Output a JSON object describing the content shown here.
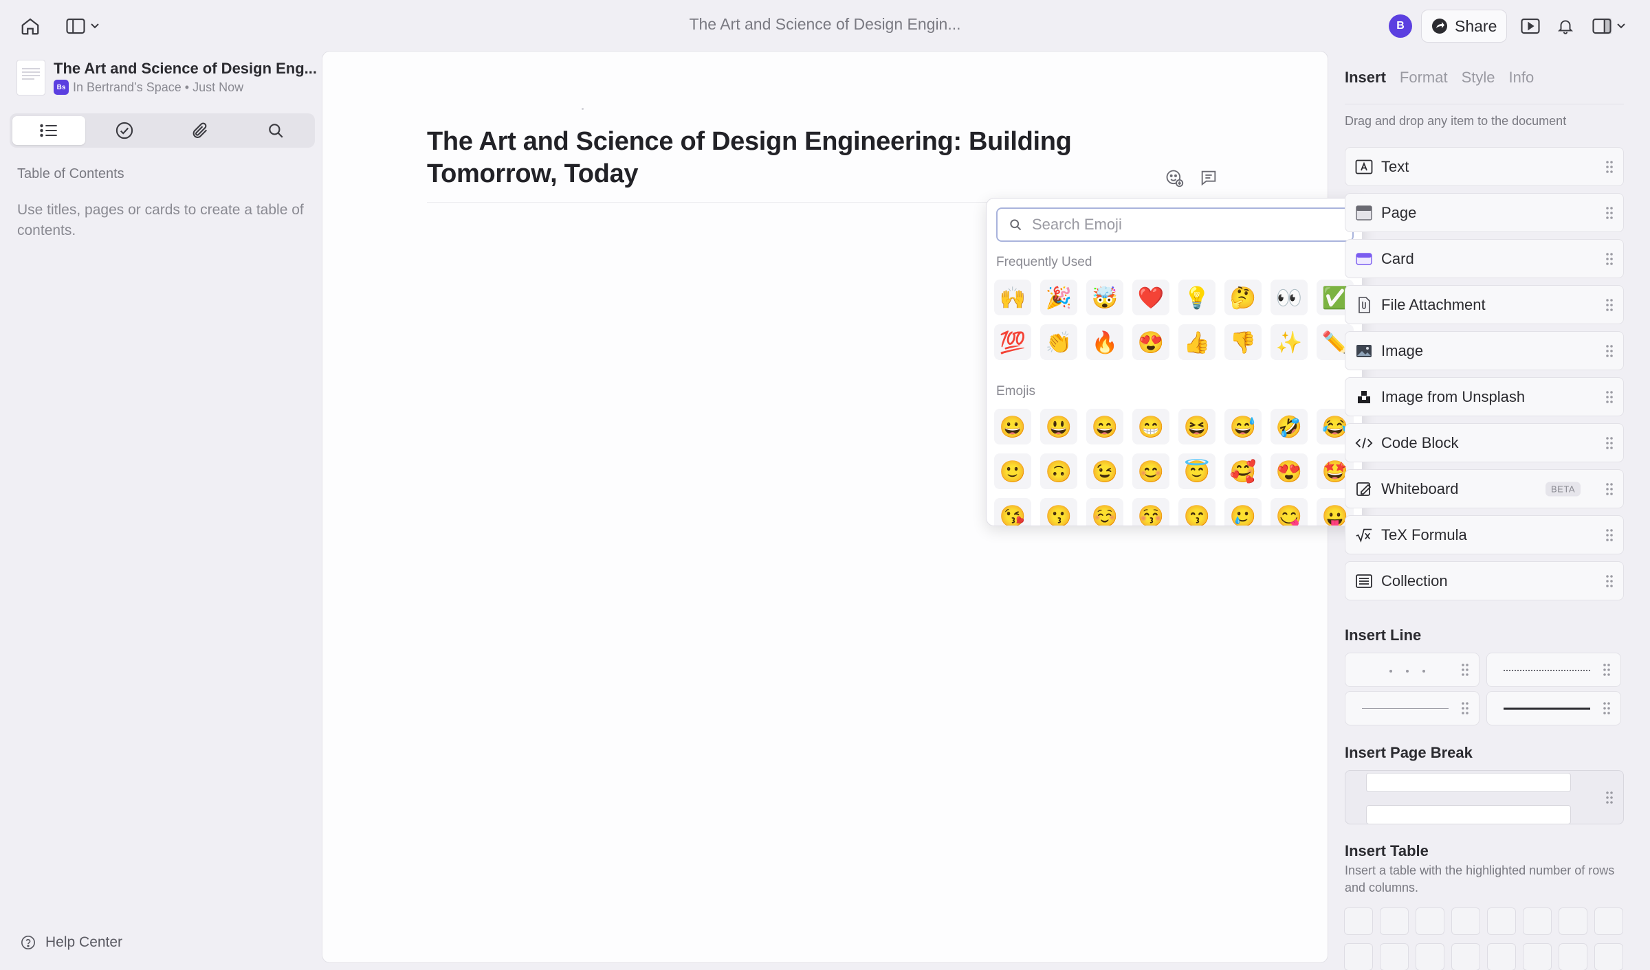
{
  "topbar": {
    "doc_title": "The Art and Science of Design Engin...",
    "avatar_initial": "B",
    "share_label": "Share"
  },
  "sidebar": {
    "doc_title": "The Art and Science of Design Eng...",
    "space_badge": "Bs",
    "doc_subtitle": "In Bertrand’s Space • Just Now",
    "tabs": [
      "list-icon",
      "check-circle-icon",
      "paperclip-icon",
      "search-icon"
    ],
    "toc_heading": "Table of Contents",
    "toc_empty": "Use titles, pages or cards to create a table of contents.",
    "help_label": "Help Center"
  },
  "document": {
    "title": "The Art and Science of Design Engineering: Building Tomorrow, Today"
  },
  "emoji_picker": {
    "search_placeholder": "Search Emoji",
    "frequent_heading": "Frequently Used",
    "frequent": [
      "🙌",
      "🎉",
      "🤯",
      "❤️",
      "💡",
      "🤔",
      "👀",
      "✅",
      "💯",
      "👏",
      "🔥",
      "😍",
      "👍",
      "👎",
      "✨",
      "✏️"
    ],
    "emojis_heading": "Emojis",
    "emojis": [
      "😀",
      "😃",
      "😄",
      "😁",
      "😆",
      "😅",
      "🤣",
      "😂",
      "🙂",
      "🙃",
      "😉",
      "😊",
      "😇",
      "🥰",
      "😍",
      "🤩",
      "😘",
      "😗",
      "☺️",
      "😚",
      "😙",
      "🥲",
      "😋",
      "😛"
    ]
  },
  "right_panel": {
    "tabs": [
      "Insert",
      "Format",
      "Style",
      "Info"
    ],
    "hint": "Drag and drop any item to the document",
    "items": [
      {
        "label": "Text",
        "icon": "text-box-icon"
      },
      {
        "label": "Page",
        "icon": "page-icon"
      },
      {
        "label": "Card",
        "icon": "card-icon"
      },
      {
        "label": "File Attachment",
        "icon": "file-attachment-icon"
      },
      {
        "label": "Image",
        "icon": "image-icon"
      },
      {
        "label": "Image from Unsplash",
        "icon": "unsplash-icon"
      },
      {
        "label": "Code Block",
        "icon": "code-icon"
      },
      {
        "label": "Whiteboard",
        "icon": "whiteboard-icon",
        "badge": "BETA"
      },
      {
        "label": "TeX Formula",
        "icon": "formula-icon"
      },
      {
        "label": "Collection",
        "icon": "collection-icon"
      }
    ],
    "insert_line_heading": "Insert Line",
    "page_break_heading": "Insert Page Break",
    "table_heading": "Insert Table",
    "table_hint": "Insert a table with the highlighted number of rows and columns."
  },
  "colors": {
    "accent": "#5b3fe0",
    "background": "#f0eff4",
    "surface": "#fdfdfe"
  }
}
